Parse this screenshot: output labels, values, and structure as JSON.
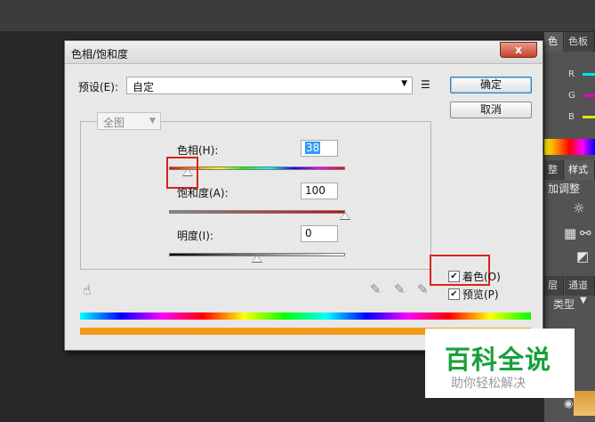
{
  "panels": {
    "tab_color": "色",
    "tab_swatches": "色板",
    "channels": [
      "R",
      "G",
      "B"
    ],
    "tab_adjust": "整",
    "tab_styles": "样式",
    "add_adjust": "加调整",
    "tab_layers": "层",
    "tab_channels": "通道",
    "kind": "类型"
  },
  "dialog": {
    "title": "色相/饱和度",
    "close_label": "x",
    "preset_label": "预设(E):",
    "preset_value": "自定",
    "ok_label": "确定",
    "cancel_label": "取消",
    "range_value": "全图",
    "hue_label": "色相(H):",
    "hue_value": "38",
    "saturation_label": "饱和度(A):",
    "saturation_value": "100",
    "lightness_label": "明度(I):",
    "lightness_value": "0",
    "colorize_label": "着色(O)",
    "preview_label": "预览(P)",
    "hue_fraction": 0.105,
    "saturation_fraction": 1.0,
    "lightness_fraction": 0.5
  },
  "watermark": {
    "main": "百科全说",
    "sub": "助你轻松解决"
  },
  "colors": {
    "accent": "#3399ff",
    "highlight_box": "#d9231c",
    "colorize_swatch": "#f29a16",
    "watermark_green": "#18a03c"
  }
}
